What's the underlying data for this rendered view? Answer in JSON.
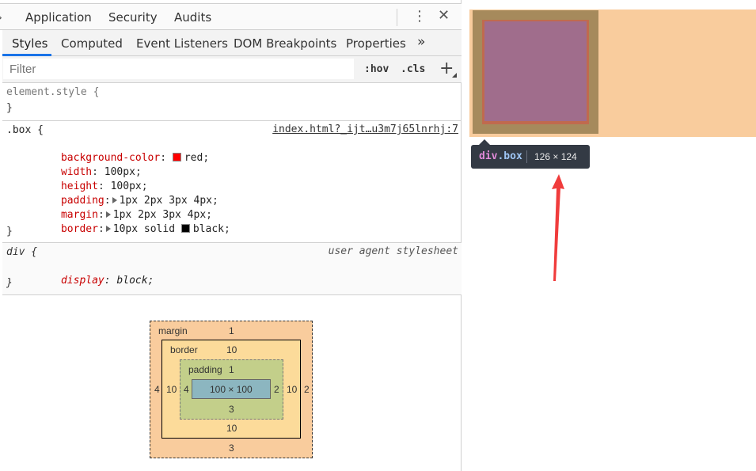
{
  "topbar": {
    "tabs": [
      "Application",
      "Security",
      "Audits"
    ],
    "more_icon": "vertical-dots-icon",
    "close_icon": "close-icon"
  },
  "subtabs": {
    "items": [
      "Styles",
      "Computed",
      "Event Listeners",
      "DOM Breakpoints",
      "Properties"
    ],
    "overflow_icon": "double-chevron-right-icon",
    "active": "Styles"
  },
  "filter": {
    "placeholder": "Filter",
    "hov": ":hov",
    "cls": ".cls",
    "plus": "+"
  },
  "rules": {
    "element_style": {
      "selector": "element.style {",
      "close": "}"
    },
    "box": {
      "selector": ".box {",
      "source": "index.html?_ijt…u3m7j65lnrhj:7",
      "props": [
        {
          "name": "background-color",
          "value": "red",
          "swatch": "#ff0000"
        },
        {
          "name": "width",
          "value": "100px"
        },
        {
          "name": "height",
          "value": "100px"
        },
        {
          "name": "padding",
          "value": "1px 2px 3px 4px"
        },
        {
          "name": "margin",
          "value": "1px 2px 3px 4px"
        },
        {
          "name": "border",
          "value_prefix": "10px solid",
          "value": "black",
          "swatch": "#000000"
        }
      ],
      "close": "}"
    },
    "div": {
      "selector": "div {",
      "source": "user agent stylesheet",
      "props": [
        {
          "name": "display",
          "value": "block"
        }
      ],
      "close": "}"
    }
  },
  "box_model": {
    "margin_label": "margin",
    "margin_top": "1",
    "margin_right": "2",
    "margin_bottom": "3",
    "margin_left": "4",
    "border_label": "border",
    "border_top": "10",
    "border_right": "10",
    "border_bottom": "10",
    "border_left": "10",
    "padding_label": "padding",
    "padding_top": "1",
    "padding_right": "2",
    "padding_bottom": "3",
    "padding_left": "4",
    "content": "100 × 100"
  },
  "preview": {
    "tooltip_tag": "div",
    "tooltip_class": ".box",
    "tooltip_dims": "126 × 124",
    "colors": {
      "margin": "#f9cc9d",
      "border": "#a68a5c",
      "padding": "#c06a4e",
      "content": "#a06d8c",
      "annotation_arrow": "#f03c3c"
    }
  }
}
